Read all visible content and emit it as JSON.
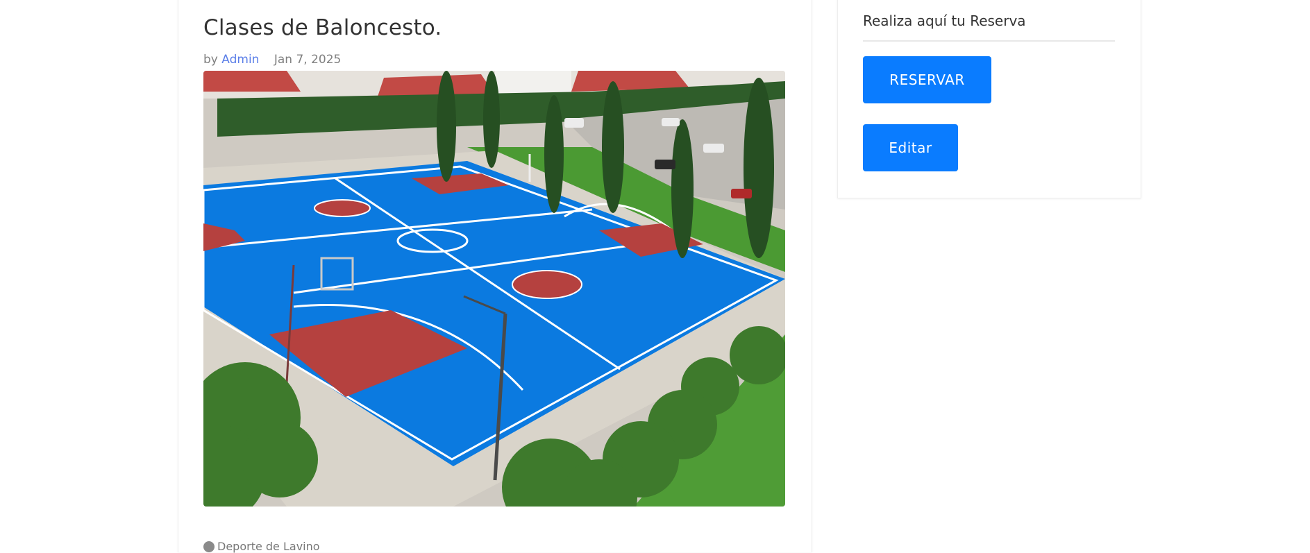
{
  "post": {
    "title": "Clases de Baloncesto.",
    "by_label": "by",
    "author": "Admin",
    "date": "Jan 7, 2025",
    "category": "Deporte de Lavino"
  },
  "sidebar": {
    "widget_title": "Realiza aquí tu Reserva",
    "reservar_label": "RESERVAR",
    "editar_label": "Editar"
  },
  "colors": {
    "accent": "#0a7cff",
    "link": "#5a7ee8",
    "court_blue": "#0b7ae0",
    "court_red": "#b5413f"
  }
}
